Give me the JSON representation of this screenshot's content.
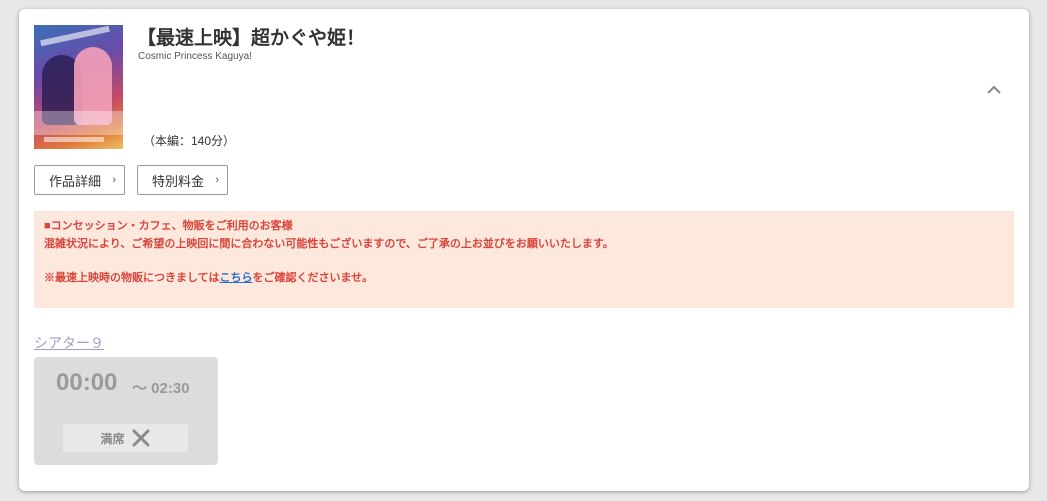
{
  "movie": {
    "title": "【最速上映】超かぐや姫！",
    "subtitle": "Cosmic Princess Kaguya!",
    "runtime": "（本編：140分）"
  },
  "buttons": {
    "detail_label": "作品詳細",
    "fee_label": "特別料金",
    "arrow": "›"
  },
  "notice": {
    "line1": "■コンセッション・カフェ、物販をご利用のお客様",
    "line2": "混雑状況により、ご希望の上映回に間に合わない可能性もございますので、ご了承の上お並びをお願いいたします。",
    "line3_prefix": "※最速上映時の物販につきましては",
    "line3_link": "こちら",
    "line3_suffix": "をご確認くださいませ。"
  },
  "showtimes": {
    "theater": "シアター９",
    "slots": [
      {
        "start": "00:00",
        "end": "～ 02:30",
        "status": "満席"
      }
    ]
  },
  "colors": {
    "notice_bg": "#fde8de",
    "notice_text": "#d9463b",
    "link": "#2a6cc9",
    "theater": "#9aa2c8",
    "slot_bg": "#dcdcdc"
  },
  "icons": {
    "collapse": "chevron-up-icon",
    "sold_out": "close-x-icon"
  }
}
